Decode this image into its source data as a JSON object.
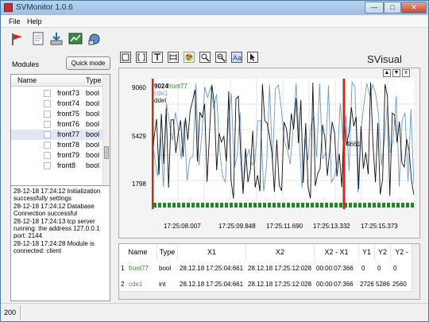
{
  "window": {
    "title": "SVMonitor 1.0.6",
    "min": "—",
    "max": "□",
    "close": "✕"
  },
  "menu": [
    "File",
    "Help"
  ],
  "toolbar_icons": [
    "flag-icon",
    "document-icon",
    "download-icon",
    "chart-icon",
    "network-icon"
  ],
  "sidebar": {
    "modules_label": "Modules",
    "quick_mode_label": "Quick mode",
    "tree_headers": {
      "name": "Name",
      "type": "Type"
    },
    "items": [
      {
        "name": "front73",
        "type": "bool"
      },
      {
        "name": "front74",
        "type": "bool"
      },
      {
        "name": "front75",
        "type": "bool"
      },
      {
        "name": "front76",
        "type": "bool"
      },
      {
        "name": "front77",
        "type": "bool"
      },
      {
        "name": "front78",
        "type": "bool"
      },
      {
        "name": "front79",
        "type": "bool"
      },
      {
        "name": "front8",
        "type": "bool"
      }
    ],
    "log": [
      "28-12-18 17:24:12 Initialization successfully settings",
      "28-12-18 17:24:12 Database Connection successful",
      "28-12-18 17:24:13 tcp server running: the address 127.0.0.1 port: 2144",
      "28-12-18 17:24:28 Module is connected: client"
    ]
  },
  "status": {
    "left": "200"
  },
  "graph": {
    "logo": "SVisual",
    "tools": [
      "square-icon",
      "bracket-icon",
      "text-icon",
      "range-icon",
      "palette-icon",
      "zoom-in-icon",
      "zoom-out-icon",
      "text-scale-icon",
      "cursor-icon"
    ],
    "win_ctrls": [
      "▲",
      "▼",
      "x"
    ],
    "legend": [
      "9024",
      "front77",
      "cde1",
      "ddel"
    ],
    "marker_value": "4661"
  },
  "chart_data": {
    "type": "line",
    "ylim": [
      1798,
      9060
    ],
    "ytick_labels": [
      "9060",
      "5429",
      "1798"
    ],
    "xtick_labels": [
      "17:25:08.007",
      "17:25:09.848",
      "17:25:11.690",
      "17:25:13.332",
      "17:25:15.373"
    ],
    "series": [
      {
        "name": "front77",
        "color": "#1f8a1f"
      },
      {
        "name": "cde1",
        "color": "#6a9ac8"
      },
      {
        "name": "ddel",
        "color": "#111111"
      }
    ],
    "marker_lines_color": "#cc2a1a"
  },
  "table": {
    "headers": [
      "Name",
      "Type",
      "X1",
      "X2",
      "X2 - X1",
      "Y1",
      "Y2",
      "Y2 -"
    ],
    "rows": [
      {
        "num": "1",
        "name": "front77",
        "name_color": "#2a8a2a",
        "type": "bool",
        "x1": "28.12.18 17:25:04:661",
        "x2": "28.12.18 17:25:12:028",
        "dx": "00:00:07:366",
        "y1": "0",
        "y2": "0",
        "dy": "0"
      },
      {
        "num": "2",
        "name": "cde1",
        "name_color": "#4a7ab8",
        "type": "int",
        "x1": "28.12.18 17:25:04:661",
        "x2": "28.12.18 17:25:12:028",
        "dx": "00:00:07:366",
        "y1": "2726",
        "y2": "5286",
        "dy": "2560"
      }
    ]
  }
}
